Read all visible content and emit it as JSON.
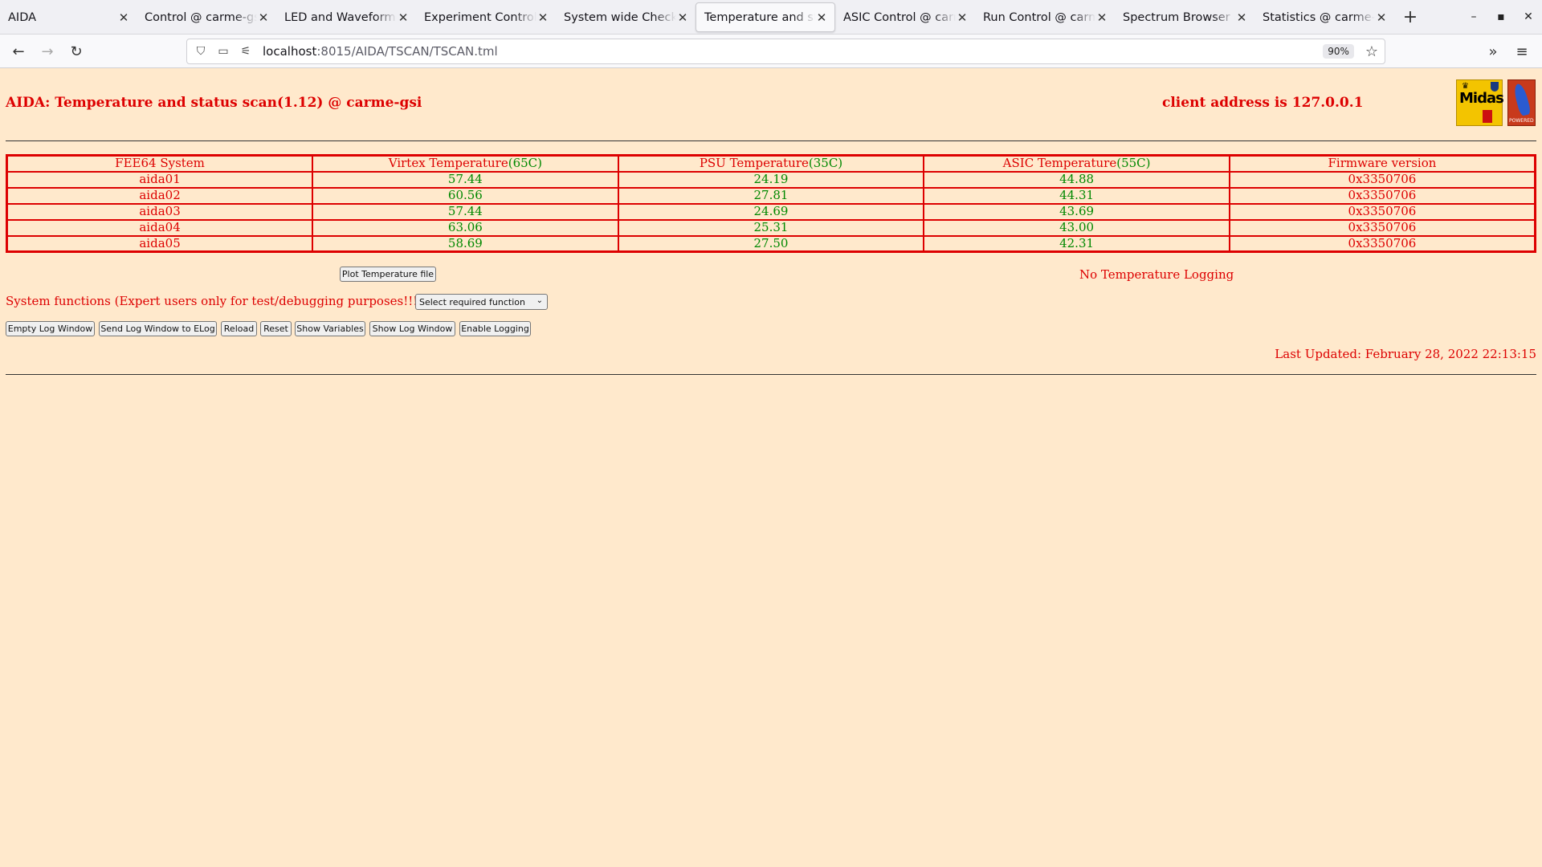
{
  "browser": {
    "tabs": [
      {
        "label": "AIDA"
      },
      {
        "label": "Control @ carme-gsi"
      },
      {
        "label": "LED and Waveform ca"
      },
      {
        "label": "Experiment Control @"
      },
      {
        "label": "System wide Checks @"
      },
      {
        "label": "Temperature and stat"
      },
      {
        "label": "ASIC Control @ carm"
      },
      {
        "label": "Run Control @ carme"
      },
      {
        "label": "Spectrum Browser @"
      },
      {
        "label": "Statistics @ carme-g"
      }
    ],
    "active_tab_index": 5,
    "url_host": "localhost",
    "url_rest": ":8015/AIDA/TSCAN/TSCAN.tml",
    "zoom": "90%"
  },
  "page": {
    "title": "AIDA: Temperature and status scan(1.12) @ carme-gsi",
    "client_address": "client address is 127.0.0.1",
    "logo_midas_text": "Midas",
    "logo_tcl_text": "POWERED",
    "table": {
      "headers": {
        "system": "FEE64 System",
        "virtex": "Virtex Temperature",
        "virtex_limit": "(65C)",
        "psu": "PSU Temperature",
        "psu_limit": "(35C)",
        "asic": "ASIC Temperature",
        "asic_limit": "(55C)",
        "firmware": "Firmware version"
      },
      "rows": [
        {
          "system": "aida01",
          "virtex": "57.44",
          "psu": "24.19",
          "asic": "44.88",
          "firmware": "0x3350706"
        },
        {
          "system": "aida02",
          "virtex": "60.56",
          "psu": "27.81",
          "asic": "44.31",
          "firmware": "0x3350706"
        },
        {
          "system": "aida03",
          "virtex": "57.44",
          "psu": "24.69",
          "asic": "43.69",
          "firmware": "0x3350706"
        },
        {
          "system": "aida04",
          "virtex": "63.06",
          "psu": "25.31",
          "asic": "43.00",
          "firmware": "0x3350706"
        },
        {
          "system": "aida05",
          "virtex": "58.69",
          "psu": "27.50",
          "asic": "42.31",
          "firmware": "0x3350706"
        }
      ]
    },
    "plot_button": "Plot Temperature file",
    "logging_status": "No Temperature Logging",
    "system_functions_label": "System functions (Expert users only for test/debugging purposes!!!)",
    "function_select": "Select required function",
    "buttons": {
      "empty_log": "Empty Log Window",
      "send_log": "Send Log Window to ELog",
      "reload": "Reload",
      "reset": "Reset",
      "show_variables": "Show Variables",
      "show_log": "Show Log Window",
      "enable_logging": "Enable Logging"
    },
    "last_updated": "Last Updated: February 28, 2022 22:13:15"
  },
  "colors": {
    "background": "#ffe9cc",
    "text_red": "#dd0000",
    "value_green": "#008800"
  }
}
